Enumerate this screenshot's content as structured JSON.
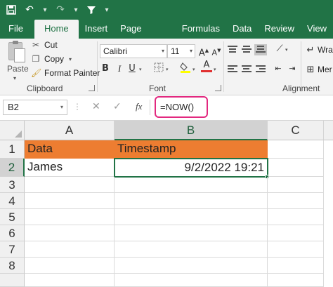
{
  "quick_access": {
    "save_icon": "save-icon",
    "undo_icon": "undo-icon",
    "redo_icon": "redo-icon",
    "filter_icon": "filter-icon"
  },
  "tabs": [
    "File",
    "Home",
    "Insert",
    "Page Layout",
    "Formulas",
    "Data",
    "Review",
    "View"
  ],
  "active_tab": "Home",
  "clipboard": {
    "paste_label": "Paste",
    "cut_label": "Cut",
    "copy_label": "Copy",
    "format_painter_label": "Format Painter",
    "group_label": "Clipboard"
  },
  "font": {
    "font_name": "Calibri",
    "font_size": "11",
    "group_label": "Font",
    "bold": "B",
    "italic": "I",
    "underline": "U",
    "grow": "A",
    "shrink": "A",
    "font_color_letter": "A",
    "highlight_color": "#ffff00",
    "font_color": "#e03030"
  },
  "alignment": {
    "group_label": "Alignment",
    "wrap_label": "Wra",
    "merge_label": "Mer"
  },
  "formula_bar": {
    "name_box": "B2",
    "cancel_icon": "cancel-icon",
    "enter_icon": "check-icon",
    "fx_label": "fx",
    "formula": "=NOW()"
  },
  "grid": {
    "columns": [
      "A",
      "B",
      "C"
    ],
    "rows": [
      "1",
      "2",
      "3",
      "4",
      "5",
      "6",
      "7",
      "8"
    ],
    "cells": {
      "A1": "Data",
      "B1": "Timestamp",
      "A2": "James",
      "B2": "9/2/2022 19:21"
    },
    "selected_cell": "B2",
    "header_fill": "#ed7d31"
  },
  "colors": {
    "brand_green": "#217346",
    "formula_highlight": "#e2287f"
  }
}
